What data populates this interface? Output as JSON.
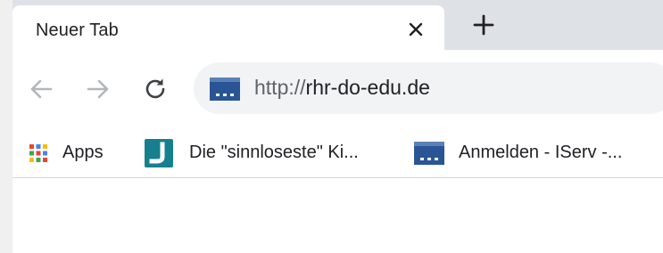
{
  "tabs": {
    "active_title": "Neuer Tab",
    "close_icon": "close-icon",
    "new_tab_icon": "plus-icon"
  },
  "toolbar": {
    "back_icon": "arrow-left-icon",
    "forward_icon": "arrow-right-icon",
    "reload_icon": "reload-icon",
    "url_scheme": "http://",
    "url_host": "rhr-do-edu.de"
  },
  "bookmarks": {
    "items": [
      {
        "label": "Apps",
        "icon": "apps-grid-icon"
      },
      {
        "label": "Die \"sinnloseste\" Ki...",
        "icon": "bookmark-favicon-icon"
      },
      {
        "label": "Anmelden - IServ -...",
        "icon": "iserv-favicon-icon"
      }
    ]
  },
  "colors": {
    "tab_strip": "#dee1e6",
    "toolbar": "#ffffff",
    "omnibox": "#f1f3f4",
    "iserv_blue": "#2a5595",
    "teal_favicon": "#16808f"
  }
}
